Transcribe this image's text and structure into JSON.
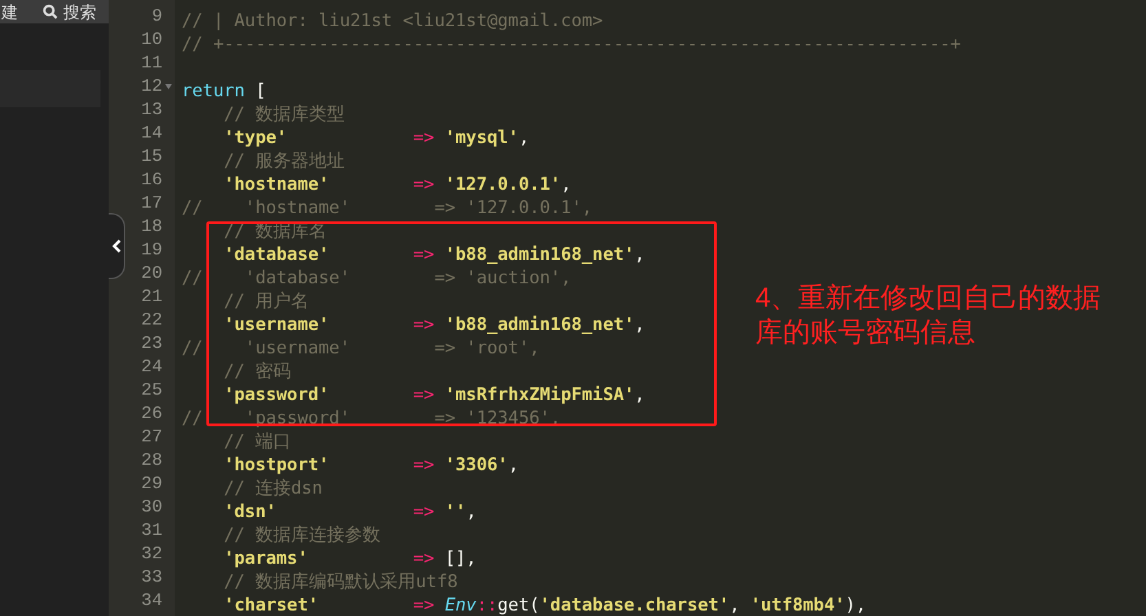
{
  "sidebar": {
    "toolbar": [
      {
        "kind": "text",
        "label": "建"
      },
      {
        "kind": "search",
        "label": "搜索"
      }
    ],
    "selected_row": true
  },
  "editor": {
    "lines": [
      {
        "number": "9",
        "foldable": false,
        "tokens": [
          {
            "text": "// | Author: liu21st <liu21st@gmail.com>",
            "kind": "comment"
          }
        ]
      },
      {
        "number": "10",
        "foldable": false,
        "tokens": [
          {
            "text": "// +---------------------------------------------------------------------+",
            "kind": "comment"
          }
        ]
      },
      {
        "number": "11",
        "foldable": false
      },
      {
        "number": "12",
        "foldable": true,
        "tokens": [
          {
            "text": "return",
            "kind": "keyword"
          },
          {
            "text": " [",
            "kind": "punct"
          }
        ]
      },
      {
        "number": "13",
        "foldable": false,
        "tokens": [
          {
            "text": "    // 数据库类型",
            "kind": "comment"
          }
        ]
      },
      {
        "number": "14",
        "foldable": false,
        "tokens": [
          {
            "text": "    'type'",
            "kind": "key"
          },
          {
            "text": "            =>",
            "kind": "op"
          },
          {
            "text": " 'mysql'",
            "kind": "string"
          },
          {
            "text": ",",
            "kind": "punct"
          }
        ]
      },
      {
        "number": "15",
        "foldable": false,
        "tokens": [
          {
            "text": "    // 服务器地址",
            "kind": "comment"
          }
        ]
      },
      {
        "number": "16",
        "foldable": false,
        "tokens": [
          {
            "text": "    'hostname'",
            "kind": "key"
          },
          {
            "text": "        =>",
            "kind": "op"
          },
          {
            "text": " '127.0.0.1'",
            "kind": "string"
          },
          {
            "text": ",",
            "kind": "punct"
          }
        ]
      },
      {
        "number": "17",
        "foldable": false,
        "tokens": [
          {
            "text": "//    'hostname'        => '127.0.0.1',",
            "kind": "comment"
          }
        ]
      },
      {
        "number": "18",
        "foldable": false,
        "tokens": [
          {
            "text": "    // 数据库名",
            "kind": "comment"
          }
        ]
      },
      {
        "number": "19",
        "foldable": false,
        "tokens": [
          {
            "text": "    'database'",
            "kind": "key"
          },
          {
            "text": "        =>",
            "kind": "op"
          },
          {
            "text": " 'b88_admin168_net'",
            "kind": "string"
          },
          {
            "text": ",",
            "kind": "punct"
          }
        ]
      },
      {
        "number": "20",
        "foldable": false,
        "tokens": [
          {
            "text": "//    'database'        => 'auction',",
            "kind": "comment"
          }
        ]
      },
      {
        "number": "21",
        "foldable": false,
        "tokens": [
          {
            "text": "    // 用户名",
            "kind": "comment"
          }
        ]
      },
      {
        "number": "22",
        "foldable": false,
        "tokens": [
          {
            "text": "    'username'",
            "kind": "key"
          },
          {
            "text": "        =>",
            "kind": "op"
          },
          {
            "text": " 'b88_admin168_net'",
            "kind": "string"
          },
          {
            "text": ",",
            "kind": "punct"
          }
        ]
      },
      {
        "number": "23",
        "foldable": false,
        "tokens": [
          {
            "text": "//    'username'        => 'root',",
            "kind": "comment"
          }
        ]
      },
      {
        "number": "24",
        "foldable": false,
        "tokens": [
          {
            "text": "    // 密码",
            "kind": "comment"
          }
        ]
      },
      {
        "number": "25",
        "foldable": false,
        "tokens": [
          {
            "text": "    'password'",
            "kind": "key"
          },
          {
            "text": "        =>",
            "kind": "op"
          },
          {
            "text": " 'msRfrhxZMipFmiSA'",
            "kind": "string"
          },
          {
            "text": ",",
            "kind": "punct"
          }
        ]
      },
      {
        "number": "26",
        "foldable": false,
        "tokens": [
          {
            "text": "//    'password'        => '123456',",
            "kind": "comment"
          }
        ]
      },
      {
        "number": "27",
        "foldable": false,
        "tokens": [
          {
            "text": "    // 端口",
            "kind": "comment"
          }
        ]
      },
      {
        "number": "28",
        "foldable": false,
        "tokens": [
          {
            "text": "    'hostport'",
            "kind": "key"
          },
          {
            "text": "        =>",
            "kind": "op"
          },
          {
            "text": " '3306'",
            "kind": "string"
          },
          {
            "text": ",",
            "kind": "punct"
          }
        ]
      },
      {
        "number": "29",
        "foldable": false,
        "tokens": [
          {
            "text": "    // 连接dsn",
            "kind": "comment"
          }
        ]
      },
      {
        "number": "30",
        "foldable": false,
        "tokens": [
          {
            "text": "    'dsn'",
            "kind": "key"
          },
          {
            "text": "             =>",
            "kind": "op"
          },
          {
            "text": " ''",
            "kind": "string"
          },
          {
            "text": ",",
            "kind": "punct"
          }
        ]
      },
      {
        "number": "31",
        "foldable": false,
        "tokens": [
          {
            "text": "    // 数据库连接参数",
            "kind": "comment"
          }
        ]
      },
      {
        "number": "32",
        "foldable": false,
        "tokens": [
          {
            "text": "    'params'",
            "kind": "key"
          },
          {
            "text": "          =>",
            "kind": "op"
          },
          {
            "text": " [],",
            "kind": "punct"
          }
        ]
      },
      {
        "number": "33",
        "foldable": false,
        "tokens": [
          {
            "text": "    // 数据库编码默认采用utf8",
            "kind": "comment"
          }
        ]
      },
      {
        "number": "34",
        "foldable": false,
        "tokens": [
          {
            "text": "    'charset'",
            "kind": "key"
          },
          {
            "text": "         =>",
            "kind": "op"
          },
          {
            "text": " Env",
            "kind": "class"
          },
          {
            "text": "::",
            "kind": "op"
          },
          {
            "text": "get(",
            "kind": "punct"
          },
          {
            "text": "'database.charset'",
            "kind": "string"
          },
          {
            "text": ", ",
            "kind": "punct"
          },
          {
            "text": "'utf8mb4'",
            "kind": "string"
          },
          {
            "text": "),",
            "kind": "punct"
          }
        ]
      }
    ]
  },
  "annotation": {
    "text": "4、重新在修改回自己的数据库的账号密码信息"
  }
}
